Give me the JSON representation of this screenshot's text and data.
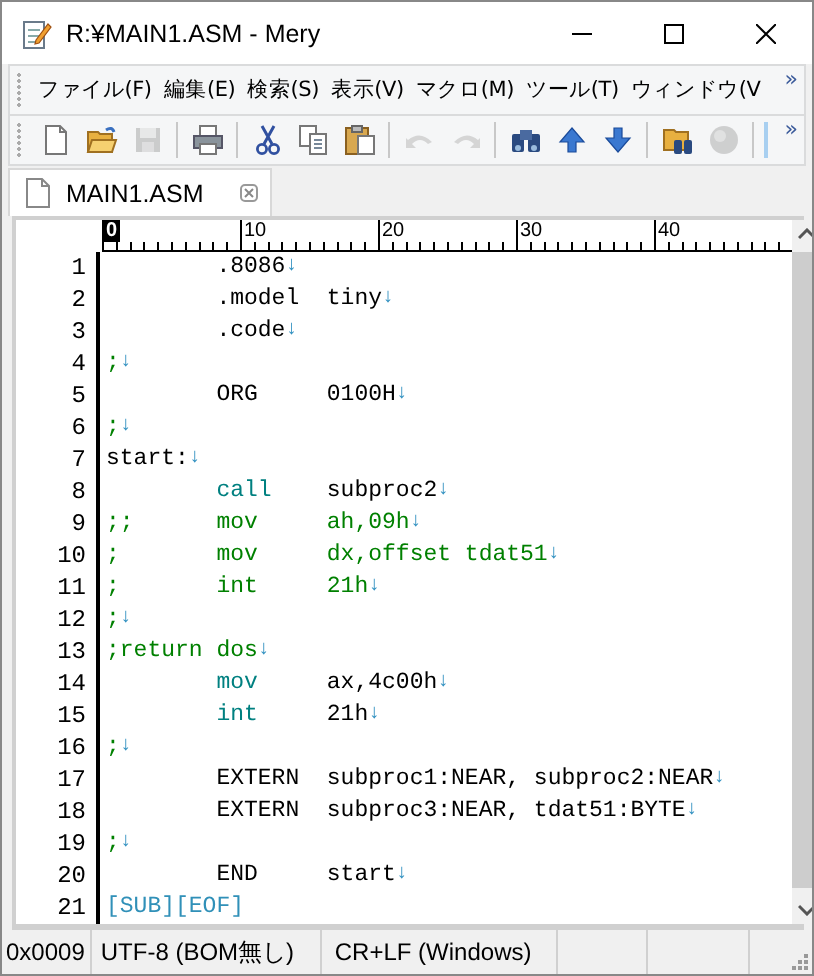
{
  "window": {
    "title": "R:¥MAIN1.ASM - Mery"
  },
  "menu": {
    "items": [
      "ファイル(F)",
      "編集(E)",
      "検索(S)",
      "表示(V)",
      "マクロ(M)",
      "ツール(T)",
      "ウィンドウ(V"
    ],
    "overflow": "»"
  },
  "toolbar": {
    "items": [
      {
        "kind": "new",
        "disabled": false
      },
      {
        "kind": "open",
        "disabled": false
      },
      {
        "kind": "save",
        "disabled": true
      },
      {
        "kind": "sep"
      },
      {
        "kind": "print",
        "disabled": false
      },
      {
        "kind": "sep"
      },
      {
        "kind": "cut",
        "disabled": false
      },
      {
        "kind": "copy",
        "disabled": false
      },
      {
        "kind": "paste",
        "disabled": false
      },
      {
        "kind": "sep"
      },
      {
        "kind": "undo",
        "disabled": true
      },
      {
        "kind": "redo",
        "disabled": true
      },
      {
        "kind": "sep"
      },
      {
        "kind": "find",
        "disabled": false
      },
      {
        "kind": "up",
        "disabled": false
      },
      {
        "kind": "down",
        "disabled": false
      },
      {
        "kind": "sep"
      },
      {
        "kind": "grep",
        "disabled": false
      },
      {
        "kind": "globe",
        "disabled": true
      },
      {
        "kind": "sep"
      }
    ],
    "overflow": "»"
  },
  "tabs": [
    {
      "label": "MAIN1.ASM",
      "selected": true
    }
  ],
  "ruler": {
    "labels": [
      {
        "text": "0",
        "selected": true
      },
      {
        "text": "10",
        "selected": false
      },
      {
        "text": "20",
        "selected": false
      },
      {
        "text": "30",
        "selected": false
      },
      {
        "text": "40",
        "selected": false
      }
    ]
  },
  "lines": [
    {
      "number": "1",
      "op": {
        "text": ".8086",
        "kind": "plain"
      },
      "eol": "↓"
    },
    {
      "number": "2",
      "op": {
        "text": ".model",
        "kind": "plain"
      },
      "args": {
        "text": "tiny",
        "kind": "plain"
      },
      "eol": "↓"
    },
    {
      "number": "3",
      "op": {
        "text": ".code",
        "kind": "plain"
      },
      "eol": "↓"
    },
    {
      "number": "4",
      "label": {
        "text": ";",
        "kind": "comment"
      },
      "eol": "↓"
    },
    {
      "number": "5",
      "op": {
        "text": "ORG",
        "kind": "plain"
      },
      "args": {
        "text": "0100H",
        "kind": "plain"
      },
      "eol": "↓"
    },
    {
      "number": "6",
      "label": {
        "text": ";",
        "kind": "comment"
      },
      "eol": "↓"
    },
    {
      "number": "7",
      "label": {
        "text": "start:",
        "kind": "plain"
      },
      "eol": "↓"
    },
    {
      "number": "8",
      "op": {
        "text": "call",
        "kind": "keyword"
      },
      "args": {
        "text": "subproc2",
        "kind": "plain"
      },
      "eol": "↓"
    },
    {
      "number": "9",
      "label": {
        "text": ";;",
        "kind": "comment"
      },
      "op": {
        "text": "mov",
        "kind": "comment"
      },
      "args": {
        "text": "ah,09h",
        "kind": "comment"
      },
      "eol": "↓"
    },
    {
      "number": "10",
      "label": {
        "text": ";",
        "kind": "comment"
      },
      "op": {
        "text": "mov",
        "kind": "comment"
      },
      "args": {
        "text": "dx,offset tdat51",
        "kind": "comment"
      },
      "eol": "↓"
    },
    {
      "number": "11",
      "label": {
        "text": ";",
        "kind": "comment"
      },
      "op": {
        "text": "int",
        "kind": "comment"
      },
      "args": {
        "text": "21h",
        "kind": "comment"
      },
      "eol": "↓"
    },
    {
      "number": "12",
      "label": {
        "text": ";",
        "kind": "comment"
      },
      "eol": "↓"
    },
    {
      "number": "13",
      "label": {
        "text": ";return dos",
        "kind": "comment"
      },
      "eol": "↓"
    },
    {
      "number": "14",
      "op": {
        "text": "mov",
        "kind": "keyword"
      },
      "args": {
        "text": "ax,4c00h",
        "kind": "plain"
      },
      "eol": "↓"
    },
    {
      "number": "15",
      "op": {
        "text": "int",
        "kind": "keyword"
      },
      "args": {
        "text": "21h",
        "kind": "plain"
      },
      "eol": "↓"
    },
    {
      "number": "16",
      "label": {
        "text": ";",
        "kind": "comment"
      },
      "eol": "↓"
    },
    {
      "number": "17",
      "op": {
        "text": "EXTERN",
        "kind": "plain"
      },
      "args": {
        "text": "subproc1:NEAR, subproc2:NEAR",
        "kind": "plain"
      },
      "eol": "↓"
    },
    {
      "number": "18",
      "op": {
        "text": "EXTERN",
        "kind": "plain"
      },
      "args": {
        "text": "subproc3:NEAR, tdat51:BYTE",
        "kind": "plain"
      },
      "eol": "↓"
    },
    {
      "number": "19",
      "label": {
        "text": ";",
        "kind": "comment"
      },
      "eol": "↓"
    },
    {
      "number": "20",
      "op": {
        "text": "END",
        "kind": "plain"
      },
      "args": {
        "text": "start",
        "kind": "plain"
      },
      "eol": "↓"
    },
    {
      "number": "21",
      "label": {
        "text": "[SUB][EOF]",
        "kind": "marker"
      }
    }
  ],
  "status_bar": {
    "position": "0x0009",
    "encoding": "UTF-8 (BOM無し)",
    "line_ending": "CR+LF (Windows)"
  }
}
